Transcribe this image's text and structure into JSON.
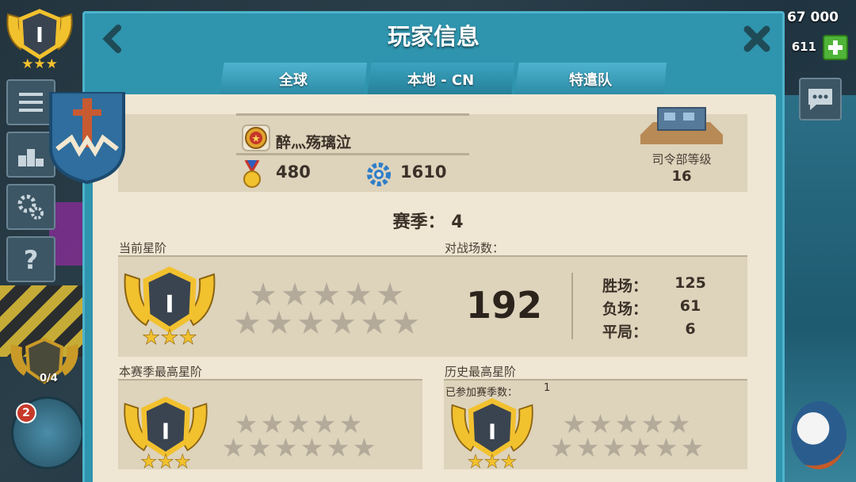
{
  "hud": {
    "currency_amount": "67 000",
    "gems_amount": "611",
    "player_rank_numeral": "I",
    "troop_count": "2",
    "badge_progress": "0/4"
  },
  "modal": {
    "title": "玩家信息",
    "tabs": [
      {
        "label": "全球"
      },
      {
        "label": "本地 - CN"
      },
      {
        "label": "特遣队"
      }
    ]
  },
  "profile": {
    "player_name": "醉灬殇璃泣",
    "medals": "480",
    "experience": "1610",
    "hq_level_label": "司令部等级",
    "hq_level": "16"
  },
  "season": {
    "label": "赛季：",
    "number": "4"
  },
  "current_rank": {
    "label": "当前星阶",
    "rank_numeral": "I",
    "stars_earned": 3
  },
  "battles": {
    "label": "对战场数：",
    "total": "192",
    "wins_label": "胜场：",
    "wins": "125",
    "losses_label": "负场：",
    "losses": "61",
    "draws_label": "平局：",
    "draws": "6"
  },
  "season_best": {
    "label": "本赛季最高星阶",
    "rank_numeral": "I"
  },
  "all_time_best": {
    "label": "历史最高星阶",
    "seasons_played_label": "已参加赛季数：",
    "seasons_played": "1",
    "rank_numeral": "I"
  },
  "colors": {
    "modal_frame": "#2f94ad",
    "paper": "#efe6d3",
    "panel": "#ded3bb",
    "gold": "#f2c12e",
    "empty_star": "#b3aa9a"
  }
}
